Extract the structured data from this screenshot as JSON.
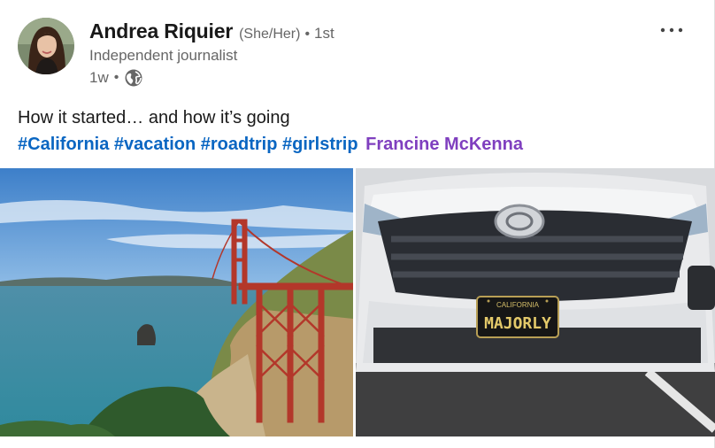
{
  "post": {
    "author": {
      "name": "Andrea Riquier",
      "pronouns": "(She/Her)",
      "degree": "1st",
      "headline": "Independent journalist",
      "time": "1w"
    },
    "text": "How it started… and how it’s going",
    "hashtags": [
      "#California",
      "#vacation",
      "#roadtrip",
      "#girlstrip"
    ],
    "mention": "Francine McKenna",
    "plate": {
      "state": "CALIFORNIA",
      "text": "MAJORLY"
    }
  },
  "icons": {
    "more": "more-dots-icon",
    "visibility": "globe-icon"
  },
  "colors": {
    "hashtag": "#0a66c2",
    "mention": "#7f3fbf",
    "secondary_text": "#666666"
  }
}
